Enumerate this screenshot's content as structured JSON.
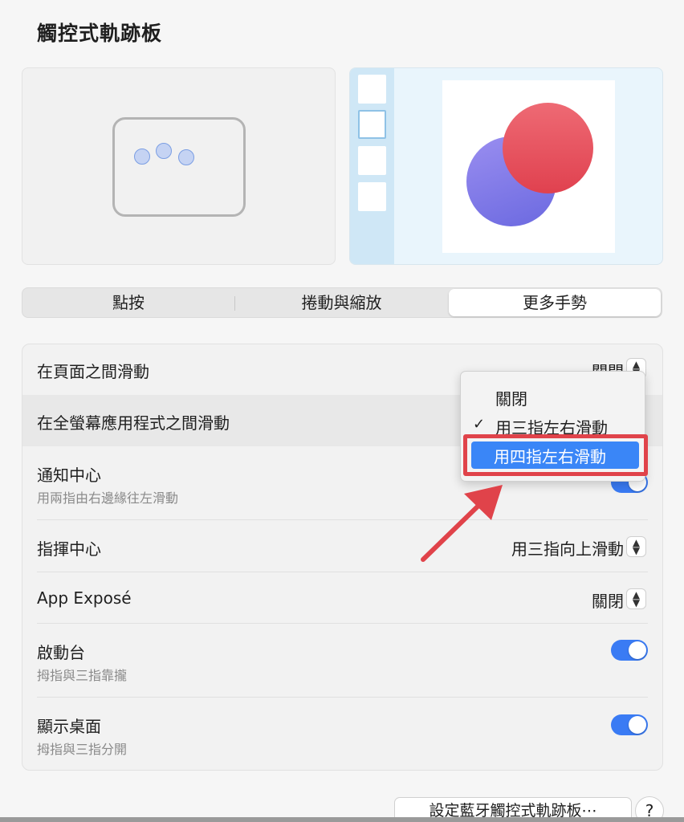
{
  "window": {
    "title": "觸控式軌跡板"
  },
  "tabs": [
    {
      "label": "點按",
      "active": false
    },
    {
      "label": "捲動與縮放",
      "active": false
    },
    {
      "label": "更多手勢",
      "active": true
    }
  ],
  "settings": {
    "swipe_pages": {
      "label": "在頁面之間滑動",
      "value": "關閉"
    },
    "swipe_fullscreen": {
      "label": "在全螢幕應用程式之間滑動"
    },
    "notification_center": {
      "label": "通知中心",
      "sub": "用兩指由右邊緣往左滑動",
      "toggle": true
    },
    "mission_control": {
      "label": "指揮中心",
      "value": "用三指向上滑動"
    },
    "app_expose": {
      "label": "App Exposé",
      "value": "關閉"
    },
    "launchpad": {
      "label": "啟動台",
      "sub": "拇指與三指靠攏",
      "toggle": true
    },
    "show_desktop": {
      "label": "顯示桌面",
      "sub": "拇指與三指分開",
      "toggle": true
    }
  },
  "dropdown": {
    "items": [
      {
        "label": "關閉",
        "checked": false
      },
      {
        "label": "用三指左右滑動",
        "checked": true
      },
      {
        "label": "用四指左右滑動",
        "highlighted": true
      }
    ],
    "check_glyph": "✓"
  },
  "footer": {
    "bluetooth_button": "設定藍牙觸控式軌跡板⋯",
    "help_button": "?"
  },
  "colors": {
    "accent": "#3a7bf4",
    "annotation": "#e0434a"
  }
}
